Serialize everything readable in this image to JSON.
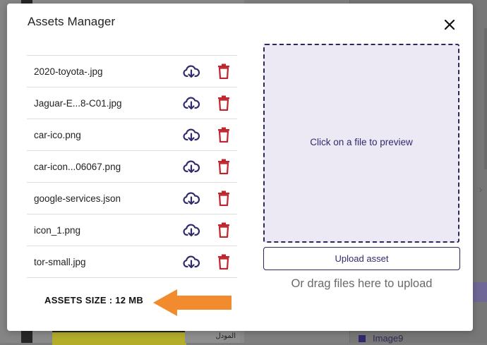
{
  "modal": {
    "title": "Assets Manager"
  },
  "files": [
    {
      "name": "2020-toyota-.jpg"
    },
    {
      "name": "Jaguar-E...8-C01.jpg"
    },
    {
      "name": "car-ico.png"
    },
    {
      "name": "car-icon...06067.png"
    },
    {
      "name": "google-services.json"
    },
    {
      "name": "icon_1.png"
    },
    {
      "name": "tor-small.jpg"
    }
  ],
  "assets_size": "ASSETS SIZE : 12 MB",
  "preview": {
    "placeholder": "Click on a file to preview"
  },
  "upload": {
    "button_label": "Upload asset",
    "drag_hint": "Or drag files here to upload"
  },
  "background": {
    "list_item": "Image9",
    "arabic_label": "المودل"
  },
  "colors": {
    "accent": "#2f2b6a",
    "delete": "#c0242c",
    "arrow": "#f28a2e",
    "preview_bg": "#ece9f5"
  },
  "icons": {
    "download": "cloud-download-icon",
    "delete": "trash-icon",
    "close": "close-icon"
  }
}
